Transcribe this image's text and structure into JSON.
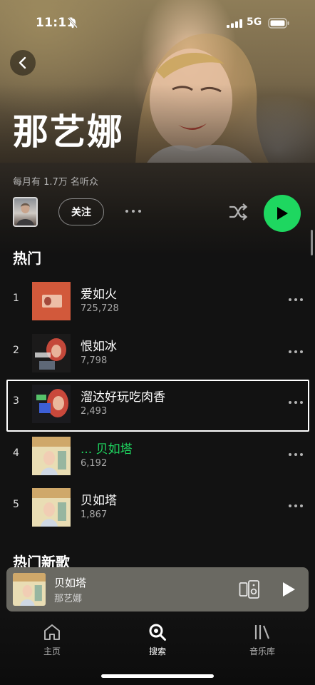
{
  "status_bar": {
    "time": "11:11",
    "network": "5G"
  },
  "artist": {
    "name": "那艺娜",
    "monthly_listeners": "每月有 1.7万 名听众"
  },
  "actions": {
    "follow_label": "关注"
  },
  "popular": {
    "title": "热门",
    "tracks": [
      {
        "rank": "1",
        "title": "爱如火",
        "plays": "725,728",
        "active": false
      },
      {
        "rank": "2",
        "title": "恨如冰",
        "plays": "7,798",
        "active": false
      },
      {
        "rank": "3",
        "title": "溜达好玩吃肉香",
        "plays": "2,493",
        "active": false
      },
      {
        "rank": "4",
        "title": "... 贝如塔",
        "plays": "6,192",
        "active": true
      },
      {
        "rank": "5",
        "title": "贝如塔",
        "plays": "1,867",
        "active": false
      }
    ]
  },
  "new_releases": {
    "title": "热门新歌"
  },
  "now_playing": {
    "title": "贝如塔",
    "artist": "那艺娜"
  },
  "nav": {
    "home": "主页",
    "search": "搜索",
    "library": "音乐库"
  },
  "colors": {
    "accent": "#1ed760",
    "background": "#121212",
    "mini_player": "#6a6962"
  },
  "icons": [
    "muted-bell-icon",
    "signal-icon",
    "battery-icon",
    "chevron-left-icon",
    "more-icon",
    "shuffle-icon",
    "play-icon",
    "devices-icon",
    "home-icon",
    "search-icon",
    "library-icon"
  ]
}
